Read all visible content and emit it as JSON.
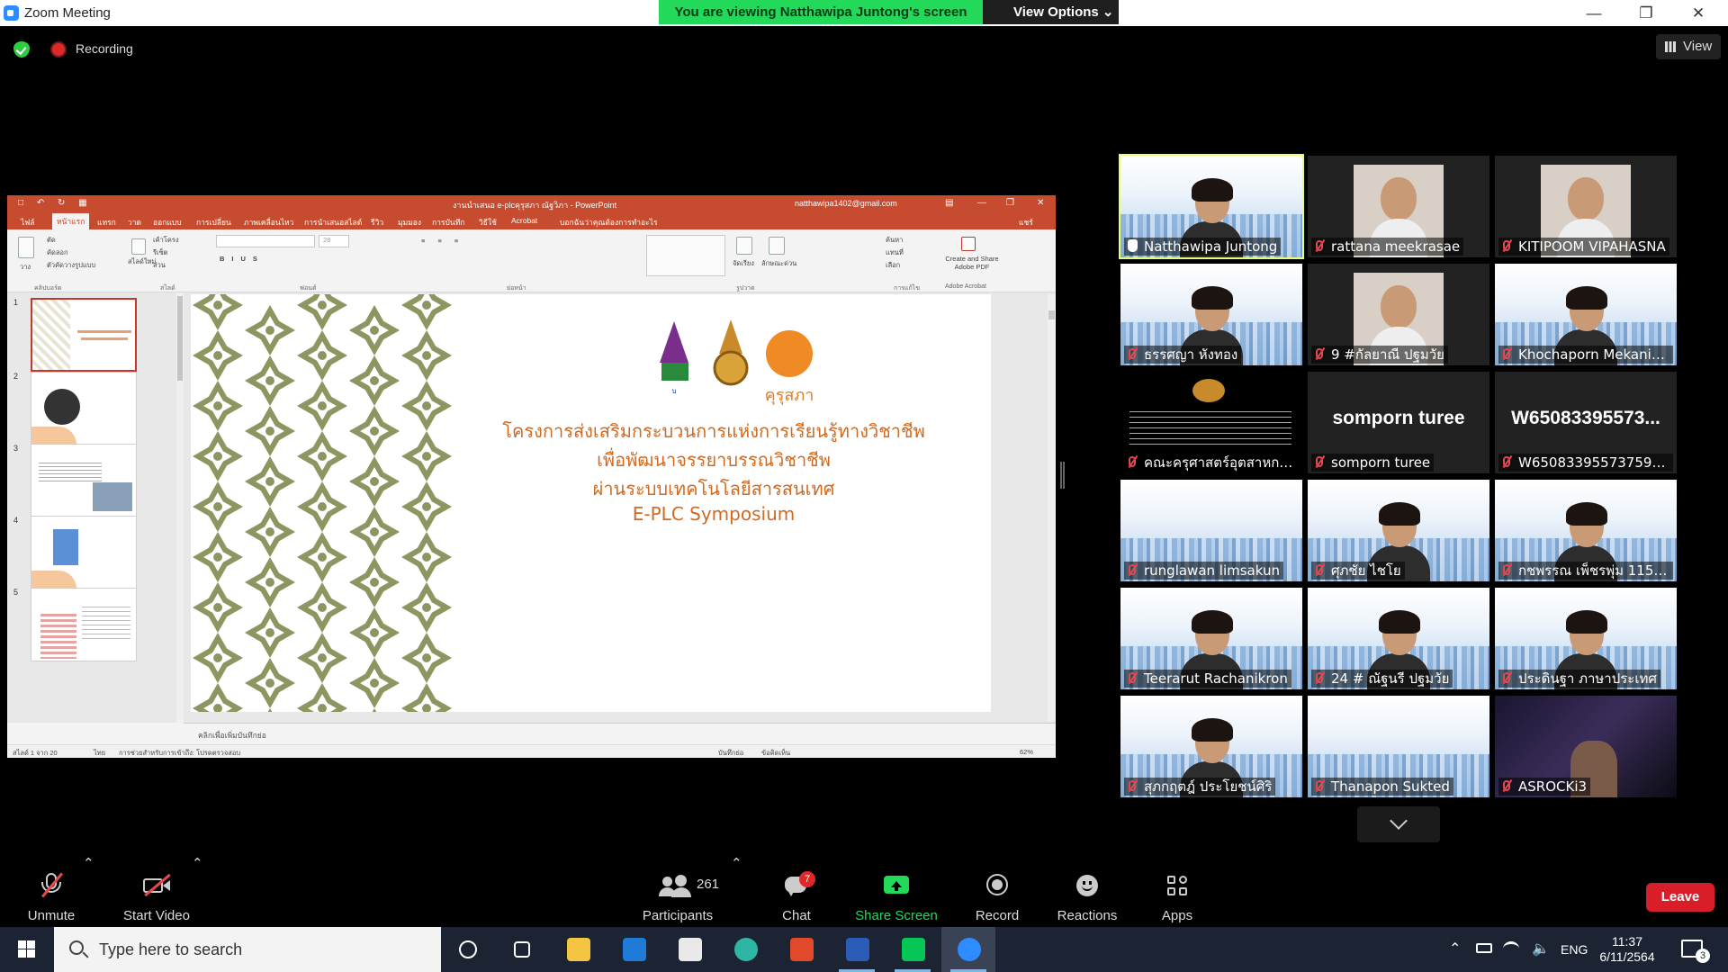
{
  "window": {
    "title": "Zoom Meeting",
    "banner": "You are viewing Natthawipa Juntong's screen",
    "view_options": "View Options"
  },
  "top": {
    "recording": "Recording",
    "view": "View"
  },
  "ppt": {
    "doc_title": "งานนำเสนอ e-plcคุรุสภา ณัฐวิภา - PowerPoint",
    "account": "natthawipa1402@gmail.com",
    "tabs": [
      "ไฟล์",
      "หน้าแรก",
      "แทรก",
      "วาด",
      "ออกแบบ",
      "การเปลี่ยน",
      "ภาพเคลื่อนไหว",
      "การนำเสนอสไลด์",
      "รีวิว",
      "มุมมอง",
      "การบันทึก",
      "วิธีใช้",
      "Acrobat",
      "บอกฉันว่าคุณต้องการทำอะไร"
    ],
    "share": "แชร์",
    "ribbon": {
      "paste": "วาง",
      "cut": "ตัด",
      "copy": "คัดลอก",
      "format_painter": "ตัวคัดวางรูปแบบ",
      "clipboard": "คลิปบอร์ด",
      "new_slide": "สไลด์ใหม่",
      "layout": "เค้าโครง",
      "reset": "รีเซ็ต",
      "section": "ส่วน",
      "slides": "สไลด์",
      "font": "ฟอนต์",
      "paragraph": "ย่อหน้า",
      "drawing": "รูปวาด",
      "arrange": "จัดเรียง",
      "quick_styles": "ลักษณะด่วน",
      "find": "ค้นหา",
      "replace": "แทนที่",
      "select": "เลือก",
      "editing": "การแก้ไข",
      "create_pdf": "Create and Share Adobe PDF",
      "adobe": "Adobe Acrobat",
      "font_size": "28"
    },
    "thumb_numbers": [
      "1",
      "2",
      "3",
      "4",
      "5"
    ],
    "slide": {
      "lines": [
        "โครงการส่งเสริมกระบวนการแห่งการเรียนรู้ทางวิชาชีพ",
        "เพื่อพัฒนาจรรยาบรรณวิชาชีพ",
        "ผ่านระบบเทคโนโลยีสารสนเทศ",
        "E-PLC Symposium"
      ],
      "logo_caption": "คุรุสภา"
    },
    "notes_placeholder": "คลิกเพื่อเพิ่มบันทึกย่อ",
    "status": {
      "slide_count": "สไลด์ 1 จาก 20",
      "lang": "ไทย",
      "accessibility": "การช่วยสำหรับการเข้าถึง: โปรดตรวจสอบ",
      "notes": "บันทึกย่อ",
      "comments": "ข้อคิดเห็น",
      "zoom": "62%"
    }
  },
  "gallery": [
    {
      "name": "Natthawipa Juntong",
      "kind": "video-plc",
      "active": true,
      "hand": true
    },
    {
      "name": "rattana meekrasae",
      "kind": "photo",
      "active": false
    },
    {
      "name": "KITIPOOM VIPAHASNA",
      "kind": "photo",
      "active": false
    },
    {
      "name": "ธรรศญา หังทอง",
      "kind": "video-plc",
      "active": false
    },
    {
      "name": "9 #กัลยาณี ปฐมวัย",
      "kind": "photo",
      "active": false
    },
    {
      "name": "Khochaporn Mekanimi...",
      "kind": "video-plc",
      "active": false
    },
    {
      "name": "คณะครุศาสตร์อุตสาหกรรม มห...",
      "kind": "slide",
      "active": false
    },
    {
      "name": "somporn turee",
      "kind": "name",
      "big": "somporn turee",
      "active": false
    },
    {
      "name": "W6508339557375973...",
      "kind": "name",
      "big": "W65083395573...",
      "active": false
    },
    {
      "name": "runglawan limsakun",
      "kind": "plc",
      "active": false
    },
    {
      "name": "ศุภชัย ไชโย",
      "kind": "video-plc",
      "active": false
    },
    {
      "name": "กชพรรณ เพ็ชรพุ่ม 1159...",
      "kind": "video-plc",
      "active": false
    },
    {
      "name": "Teerarut Rachanikron",
      "kind": "video-plc",
      "active": false
    },
    {
      "name": "24 # ณัฐนรี ปฐมวัย",
      "kind": "video-plc",
      "active": false
    },
    {
      "name": "ประดินฐา ภาษาประเทศ",
      "kind": "video-plc",
      "active": false
    },
    {
      "name": "สุภกฤตฎ์ ประโยชน์ศิริ",
      "kind": "video-plc",
      "active": false
    },
    {
      "name": "Thanapon Sukted",
      "kind": "plc",
      "active": false
    },
    {
      "name": "ASROCKi3",
      "kind": "dark",
      "active": false
    }
  ],
  "toolbar": {
    "unmute": "Unmute",
    "start_video": "Start Video",
    "participants": "Participants",
    "participants_count": "261",
    "chat": "Chat",
    "chat_badge": "7",
    "share_screen": "Share Screen",
    "record": "Record",
    "reactions": "Reactions",
    "apps": "Apps",
    "leave": "Leave"
  },
  "taskbar": {
    "search_placeholder": "Type here to search",
    "lang": "ENG",
    "time": "11:37",
    "date": "6/11/2564",
    "notif_count": "3"
  },
  "colors": {
    "zoom_blue": "#2d8cff",
    "banner_green": "#23d959",
    "leave_red": "#d81e28",
    "ppt_accent": "#c74b2e",
    "share_green": "#23d959",
    "slide_text": "#d2691e"
  }
}
